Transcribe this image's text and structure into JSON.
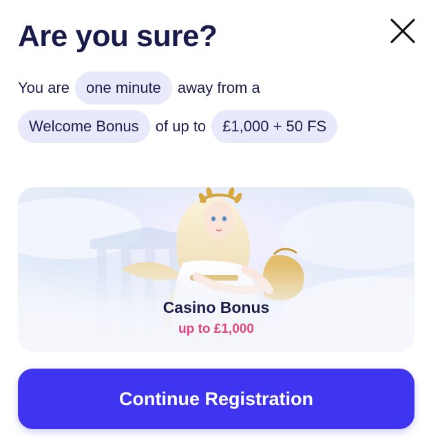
{
  "modal": {
    "title": "Are you sure?",
    "close_icon": "close-icon",
    "message": {
      "part1": "You are",
      "chip_time": "one minute",
      "part2": "away from a",
      "chip_bonus": "Welcome Bonus",
      "part3": "of up to",
      "chip_amount": "£1,000 + 50 FS"
    },
    "card": {
      "title": "Casino Bonus",
      "subtitle": "up to £1,000"
    },
    "cta_label": "Continue Registration"
  },
  "colors": {
    "title": "#171a4a",
    "chip_bg": "#e8e9fb",
    "accent_pink": "#e0457b",
    "cta_bg": "#3f34f0"
  }
}
